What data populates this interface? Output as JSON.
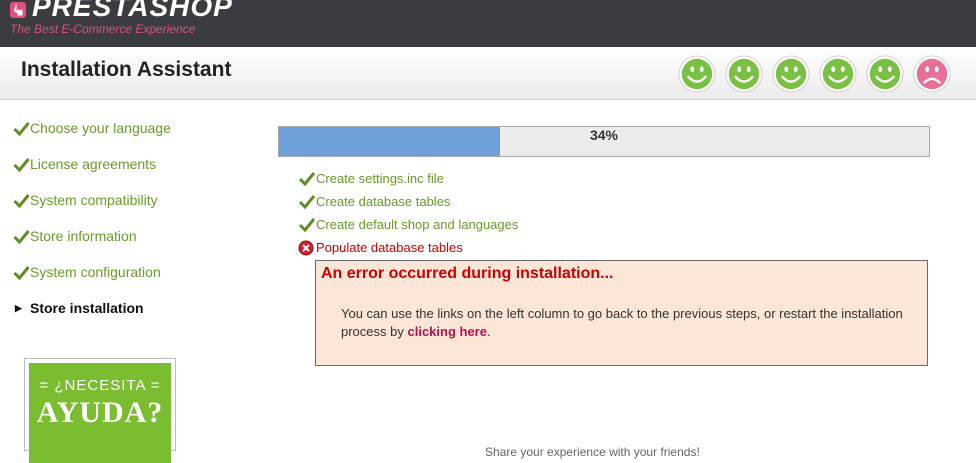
{
  "brand": {
    "name": "PRESTASHOP",
    "tagline": "The Best E-Commerce Experience"
  },
  "header": {
    "title": "Installation Assistant",
    "progress_smileys": [
      "happy",
      "happy",
      "happy",
      "happy",
      "happy",
      "sad"
    ],
    "colors": {
      "happy": "#7ac143",
      "sad": "#e6709a"
    }
  },
  "steps": [
    {
      "label": "Choose your language",
      "state": "done"
    },
    {
      "label": "License agreements",
      "state": "done"
    },
    {
      "label": "System compatibility",
      "state": "done"
    },
    {
      "label": "Store information",
      "state": "done"
    },
    {
      "label": "System configuration",
      "state": "done"
    },
    {
      "label": "Store installation",
      "state": "active"
    }
  ],
  "help_banner": {
    "line1": "= ¿NECESITA =",
    "line2": "AYUDA?"
  },
  "progress": {
    "percent": 34,
    "label": "34%"
  },
  "tasks": [
    {
      "label": "Create settings.inc file",
      "state": "done"
    },
    {
      "label": "Create database tables",
      "state": "done"
    },
    {
      "label": "Create default shop and languages",
      "state": "done"
    },
    {
      "label": "Populate database tables",
      "state": "error"
    }
  ],
  "error": {
    "title": "An error occurred during installation...",
    "message_before": "You can use the links on the left column to go back to the previous steps, or restart the installation process by ",
    "link_text": "clicking here",
    "message_after": "."
  },
  "footer_partial": "Share your experience with your friends!"
}
